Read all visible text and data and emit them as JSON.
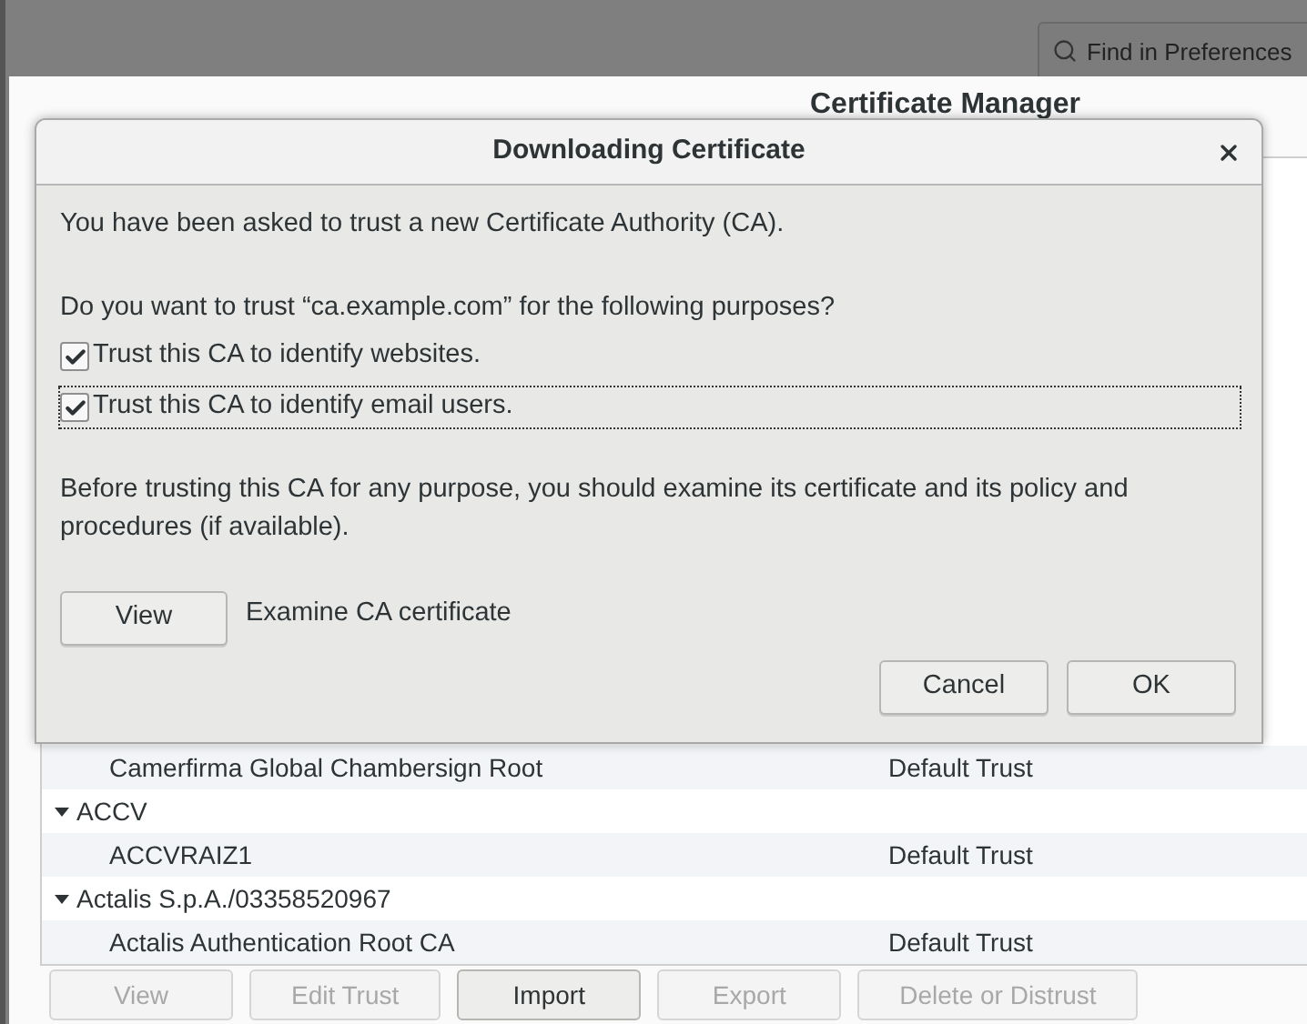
{
  "preferences": {
    "search": {
      "placeholder": "Find in Preferences"
    }
  },
  "certificate_manager": {
    "title": "Certificate Manager",
    "tree": [
      {
        "kind": "certificate",
        "name": "Camerfirma Global Chambersign Root",
        "trust": "Default Trust"
      },
      {
        "kind": "group",
        "name": "ACCV",
        "expanded": true,
        "children": [
          {
            "kind": "certificate",
            "name": "ACCVRAIZ1",
            "trust": "Default Trust"
          }
        ]
      },
      {
        "kind": "group",
        "name": "Actalis S.p.A./03358520967",
        "expanded": true,
        "children": [
          {
            "kind": "certificate",
            "name": "Actalis Authentication Root CA",
            "trust": "Default Trust"
          }
        ]
      }
    ],
    "buttons": [
      {
        "label": "View",
        "disabled": true
      },
      {
        "label": "Edit Trust",
        "disabled": true
      },
      {
        "label": "Import",
        "disabled": false
      },
      {
        "label": "Export",
        "disabled": true
      },
      {
        "label": "Delete or Distrust",
        "disabled": true
      }
    ]
  },
  "dialog": {
    "title": "Downloading Certificate",
    "intro": "You have been asked to trust a new Certificate Authority (CA).",
    "question": "Do you want to trust “ca.example.com” for the following purposes?",
    "options": [
      {
        "label": "Trust this CA to identify websites.",
        "checked": true,
        "focused": false
      },
      {
        "label": "Trust this CA to identify email users.",
        "checked": true,
        "focused": true
      }
    ],
    "note": "Before trusting this CA for any purpose, you should examine its certificate and its policy and procedures (if available).",
    "view_button": "View",
    "view_hint": "Examine CA certificate",
    "buttons": [
      "Cancel",
      "OK"
    ]
  }
}
